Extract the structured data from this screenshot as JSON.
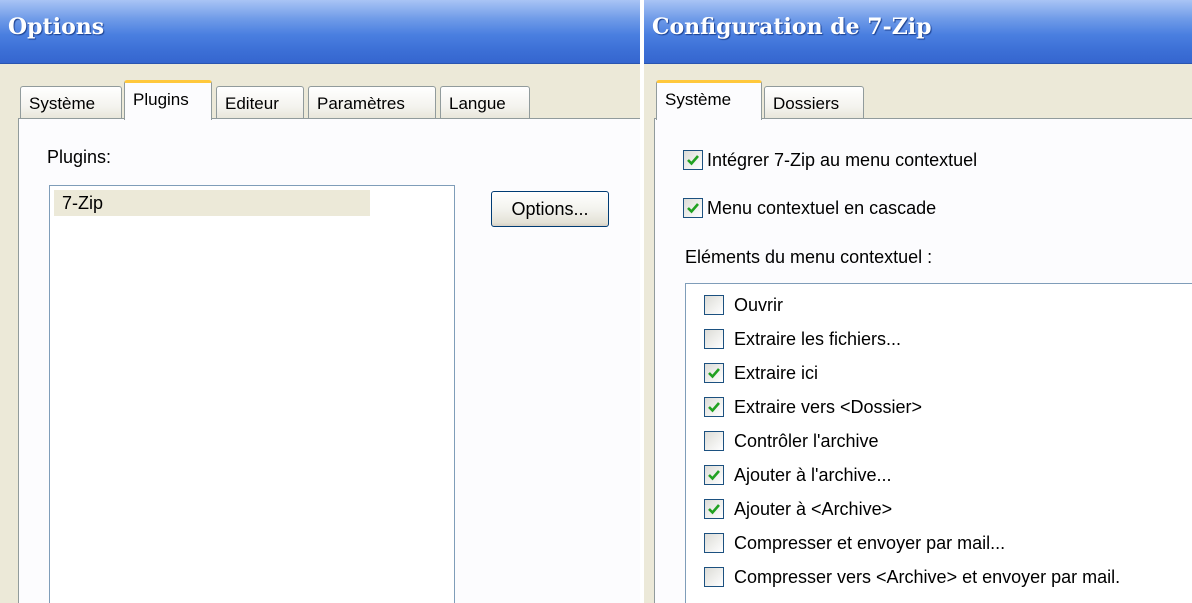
{
  "left_window": {
    "title": "Options",
    "tabs": [
      {
        "label": "Système",
        "active": false
      },
      {
        "label": "Plugins",
        "active": true
      },
      {
        "label": "Editeur",
        "active": false
      },
      {
        "label": "Paramètres",
        "active": false
      },
      {
        "label": "Langue",
        "active": false
      }
    ],
    "plugins_label": "Plugins:",
    "plugins_list": [
      "7-Zip"
    ],
    "options_button": "Options..."
  },
  "right_window": {
    "title": "Configuration de 7-Zip",
    "tabs": [
      {
        "label": "Système",
        "active": true
      },
      {
        "label": "Dossiers",
        "active": false
      }
    ],
    "integrate_checkbox": {
      "label": "Intégrer 7-Zip au menu contextuel",
      "checked": true
    },
    "cascade_checkbox": {
      "label": "Menu contextuel en cascade",
      "checked": true
    },
    "elements_label": "Eléments du menu contextuel :",
    "menu_items": [
      {
        "label": "Ouvrir",
        "checked": false
      },
      {
        "label": "Extraire les fichiers...",
        "checked": false
      },
      {
        "label": "Extraire ici",
        "checked": true
      },
      {
        "label": "Extraire vers <Dossier>",
        "checked": true
      },
      {
        "label": "Contrôler l'archive",
        "checked": false
      },
      {
        "label": "Ajouter à l'archive...",
        "checked": true
      },
      {
        "label": "Ajouter à <Archive>",
        "checked": true
      },
      {
        "label": "Compresser et envoyer par mail...",
        "checked": false
      },
      {
        "label": "Compresser vers <Archive> et envoyer par mail.",
        "checked": false
      }
    ]
  },
  "colors": {
    "titlebar": "#3c6fd6",
    "tab_active_highlight": "#ffc83c",
    "checkmark": "#21a121"
  }
}
